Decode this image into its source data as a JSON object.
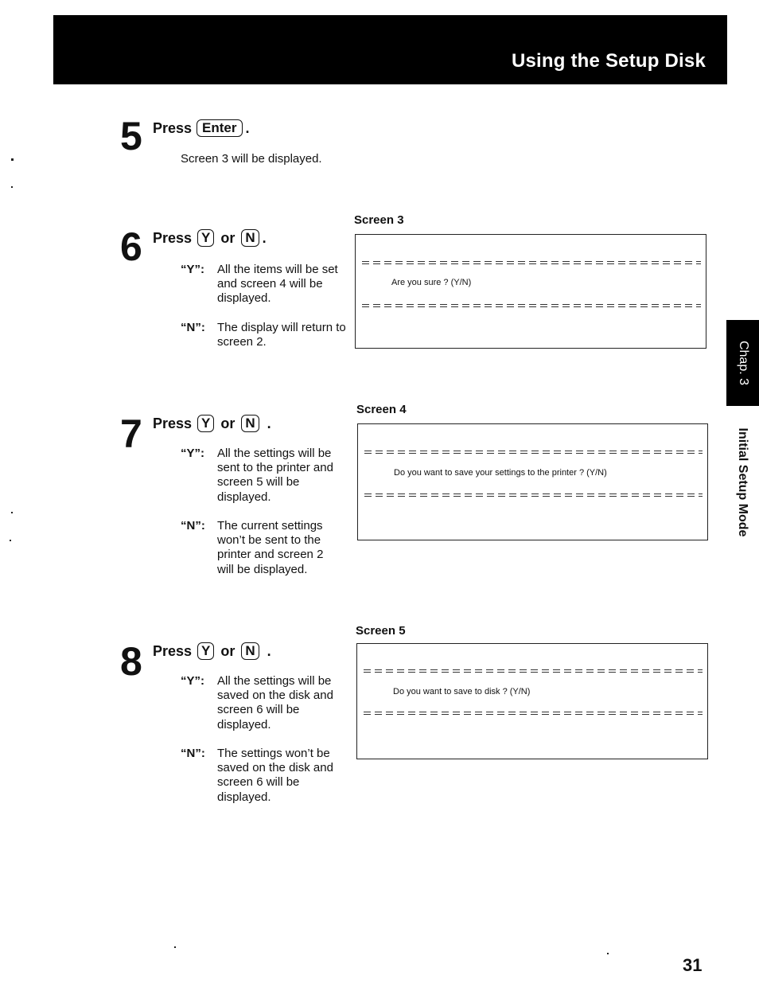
{
  "header": {
    "title": "Using the Setup Disk"
  },
  "steps": [
    {
      "number": "5",
      "press": "Press",
      "keys": [
        "Enter"
      ],
      "or": "",
      "description": "Screen 3 will be displayed."
    },
    {
      "number": "6",
      "press": "Press",
      "keys": [
        "Y",
        "N"
      ],
      "or": "or",
      "options": [
        {
          "key": "“Y”:",
          "text": "All the items will be set and screen 4 will be displayed."
        },
        {
          "key": "“N”:",
          "text": "The display will return to screen 2."
        }
      ]
    },
    {
      "number": "7",
      "press": "Press",
      "keys": [
        "Y",
        "N"
      ],
      "or": "or",
      "options": [
        {
          "key": "“Y”:",
          "text": "All the settings will be sent to the printer and screen 5 will be displayed."
        },
        {
          "key": "“N”:",
          "text": "The current settings won’t be sent to the printer and screen 2 will be displayed."
        }
      ]
    },
    {
      "number": "8",
      "press": "Press",
      "keys": [
        "Y",
        "N"
      ],
      "or": "or",
      "options": [
        {
          "key": "“Y”:",
          "text": "All the settings will be saved on the disk and screen 6 will be displayed."
        },
        {
          "key": "“N”:",
          "text": "The settings won’t be saved on the disk and screen 6 will be displayed."
        }
      ]
    }
  ],
  "screens": [
    {
      "label": "Screen 3",
      "prompt": "Are you sure  ?  (Y/N)"
    },
    {
      "label": "Screen 4",
      "prompt": "Do you want to save your settings to the printer ? (Y/N)"
    },
    {
      "label": "Screen 5",
      "prompt": "Do you want to save to disk ? (Y/N)"
    }
  ],
  "side": {
    "chapter_tab": "Chap. 3",
    "chapter_title": "Initial Setup Mode"
  },
  "page_number": "31",
  "punctuation": {
    "period": "."
  }
}
